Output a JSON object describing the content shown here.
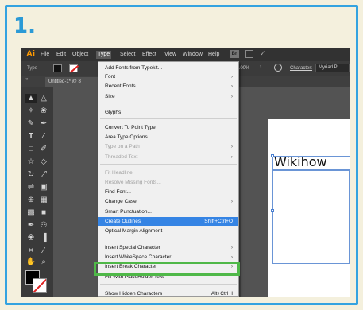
{
  "step_number": "1.",
  "menubar": {
    "logo": "Ai",
    "items": [
      "File",
      "Edit",
      "Object",
      "Type",
      "Select",
      "Effect",
      "View",
      "Window",
      "Help"
    ],
    "active": "Type",
    "bridge_label": "Br"
  },
  "control_bar": {
    "label": "Type",
    "zoom": "100%",
    "character_label": "Character:",
    "font_value": "Myriad P"
  },
  "tab": {
    "document": "Untitled-1* @ 8",
    "collapse_glyph": "«"
  },
  "canvas": {
    "text": "Wikihow"
  },
  "type_menu": {
    "items": [
      {
        "label": "Add Fonts from Typekit...",
        "submenu": false,
        "disabled": false,
        "shortcut": ""
      },
      {
        "label": "Font",
        "submenu": true,
        "disabled": false,
        "shortcut": ""
      },
      {
        "label": "Recent Fonts",
        "submenu": true,
        "disabled": false,
        "shortcut": ""
      },
      {
        "label": "Size",
        "submenu": true,
        "disabled": false,
        "shortcut": ""
      },
      {
        "label": "Glyphs",
        "submenu": false,
        "disabled": false,
        "shortcut": ""
      },
      {
        "label": "Convert To Point Type",
        "submenu": false,
        "disabled": false,
        "shortcut": ""
      },
      {
        "label": "Area Type Options...",
        "submenu": false,
        "disabled": false,
        "shortcut": ""
      },
      {
        "label": "Type on a Path",
        "submenu": true,
        "disabled": true,
        "shortcut": ""
      },
      {
        "label": "Threaded Text",
        "submenu": true,
        "disabled": true,
        "shortcut": ""
      },
      {
        "label": "Fit Headline",
        "submenu": false,
        "disabled": true,
        "shortcut": ""
      },
      {
        "label": "Resolve Missing Fonts...",
        "submenu": false,
        "disabled": true,
        "shortcut": ""
      },
      {
        "label": "Find Font...",
        "submenu": false,
        "disabled": false,
        "shortcut": ""
      },
      {
        "label": "Change Case",
        "submenu": true,
        "disabled": false,
        "shortcut": ""
      },
      {
        "label": "Smart Punctuation...",
        "submenu": false,
        "disabled": false,
        "shortcut": ""
      },
      {
        "label": "Create Outlines",
        "submenu": false,
        "disabled": false,
        "shortcut": "Shift+Ctrl+O",
        "highlighted": true
      },
      {
        "label": "Optical Margin Alignment",
        "submenu": false,
        "disabled": false,
        "shortcut": ""
      },
      {
        "label": "Insert Special Character",
        "submenu": true,
        "disabled": false,
        "shortcut": ""
      },
      {
        "label": "Insert WhiteSpace Character",
        "submenu": true,
        "disabled": false,
        "shortcut": ""
      },
      {
        "label": "Insert Break Character",
        "submenu": true,
        "disabled": false,
        "shortcut": ""
      },
      {
        "label": "Fill With PlaceHolder Text",
        "submenu": false,
        "disabled": false,
        "shortcut": ""
      },
      {
        "label": "Show Hidden Characters",
        "submenu": false,
        "disabled": false,
        "shortcut": "Alt+Ctrl+I"
      }
    ]
  },
  "colors": {
    "frame_border": "#34a3e0",
    "step_number": "#2b9ad6",
    "highlight_box": "#4fb848",
    "menu_highlight": "#3584e4",
    "ai_logo": "#ff9a00"
  },
  "icons": {
    "submenu": "›"
  }
}
